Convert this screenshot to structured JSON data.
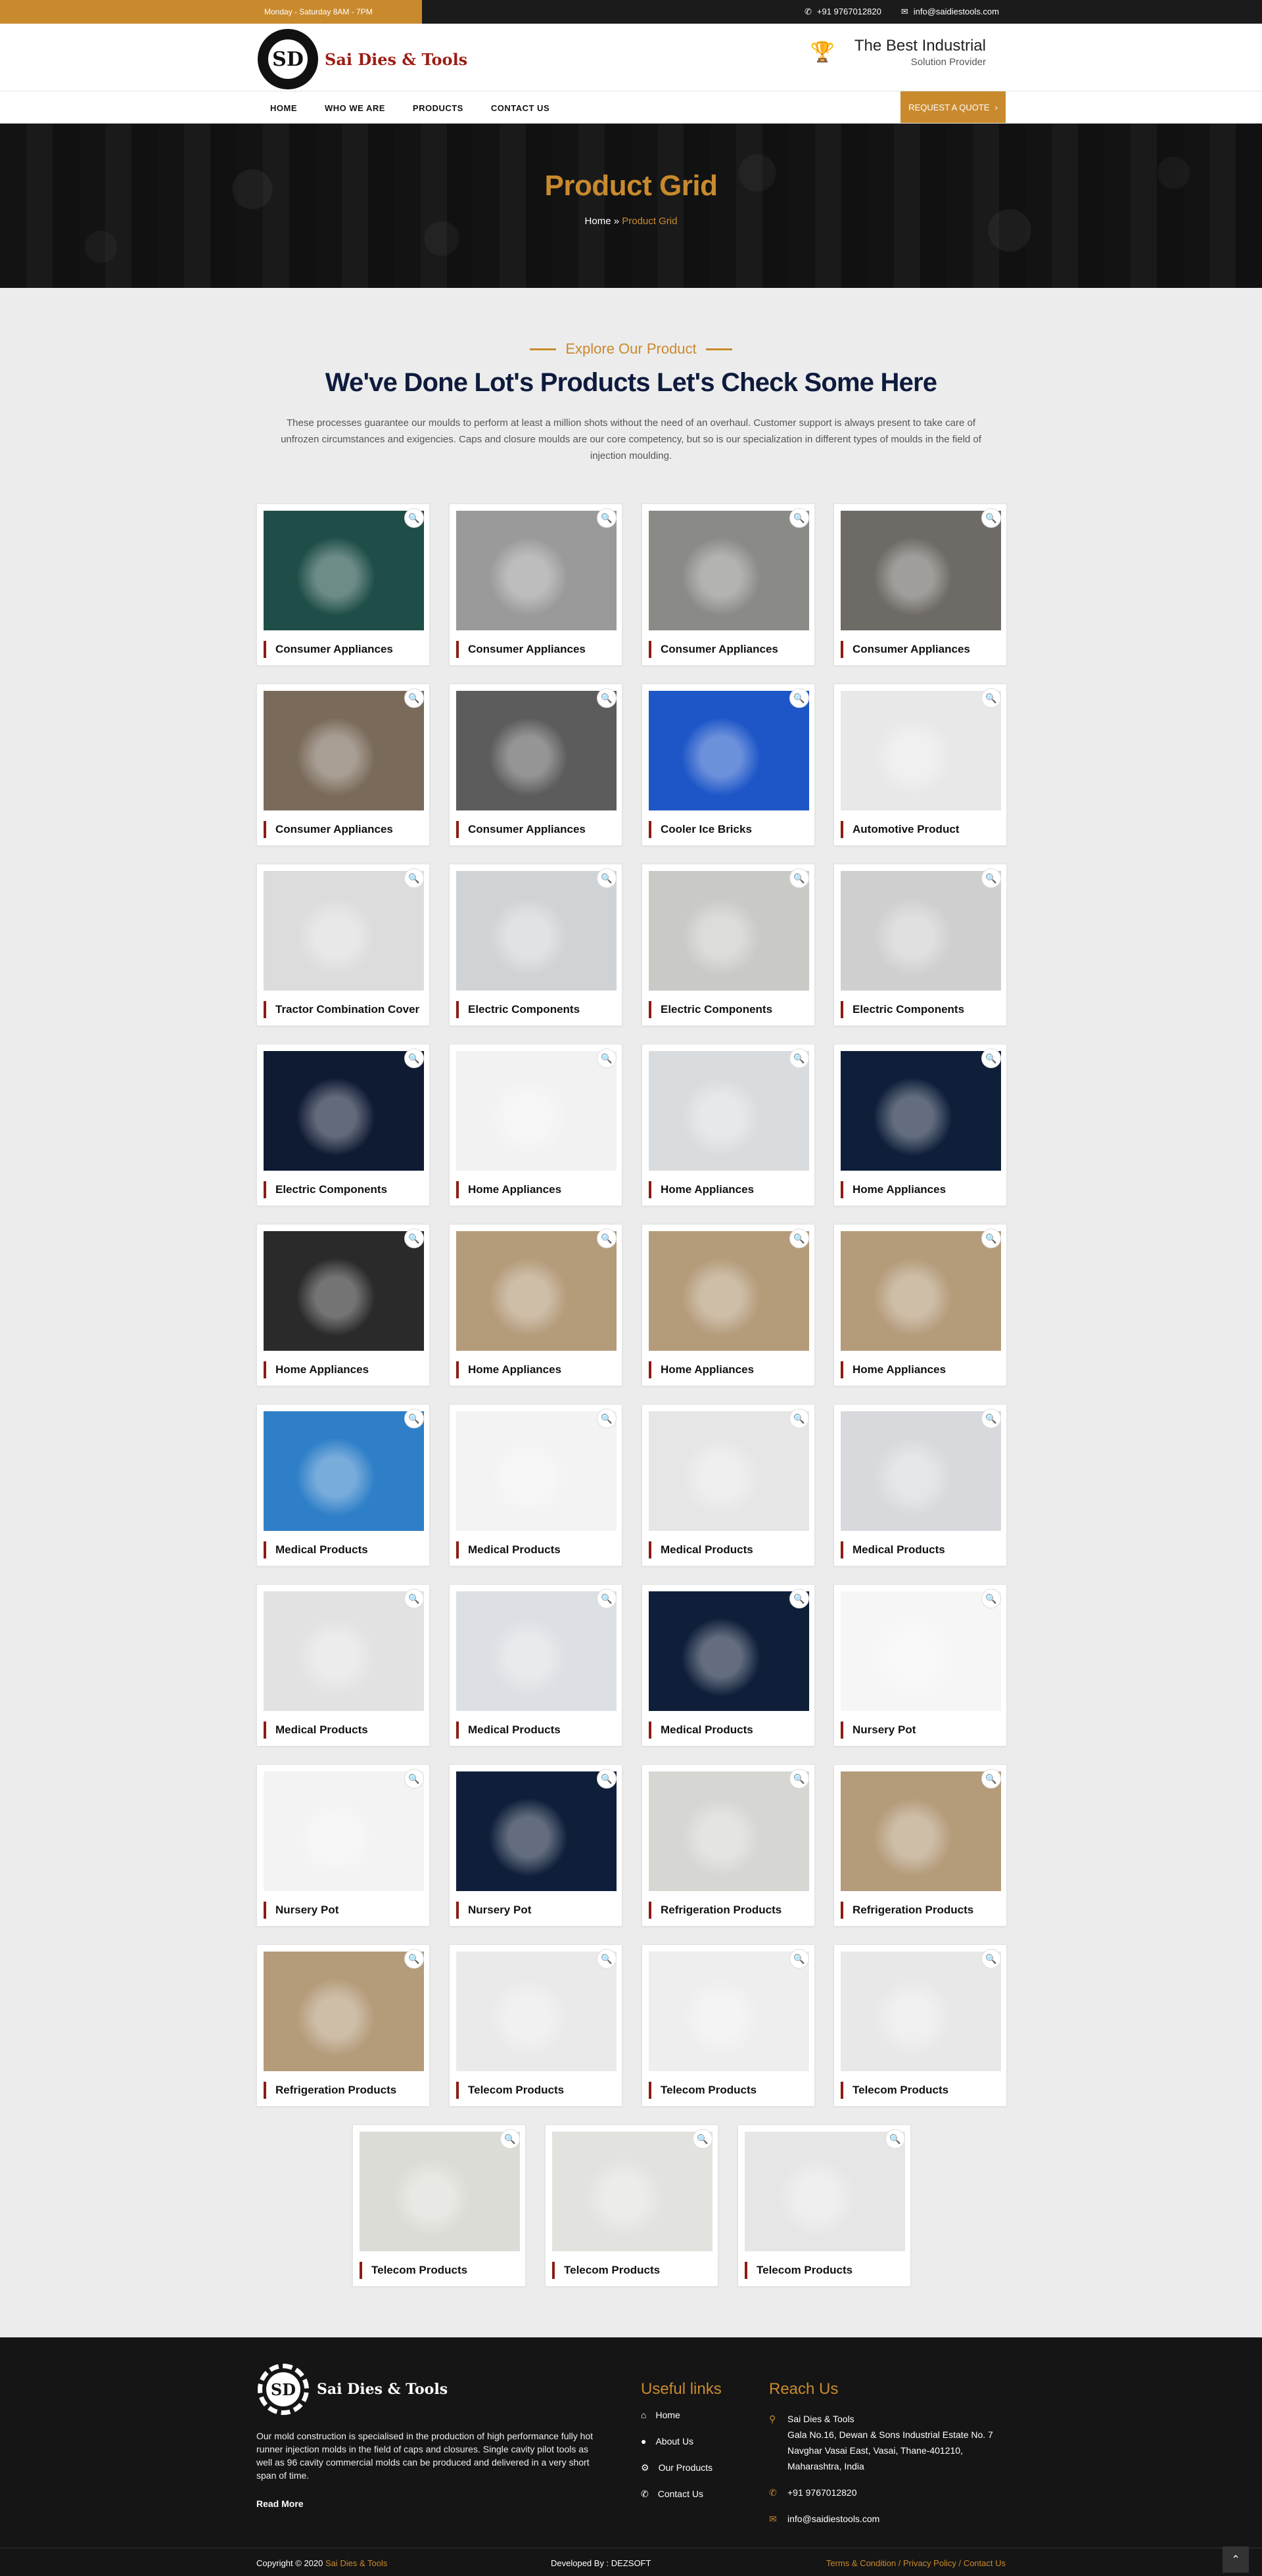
{
  "topbar": {
    "hours": "Monday - Saturday   8AM - 7PM",
    "phone": "+91 9767012820",
    "email": "info@saidiestools.com"
  },
  "brand": {
    "logo_letters": "SD",
    "name": "Sai Dies & Tools"
  },
  "tagline": {
    "line1": "The Best Industrial",
    "line2": "Solution Provider"
  },
  "nav": {
    "items": [
      "HOME",
      "WHO WE ARE",
      "PRODUCTS",
      "CONTACT US"
    ],
    "quote": "REQUEST A QUOTE"
  },
  "hero": {
    "title": "Product Grid",
    "crumb_home": "Home",
    "crumb_sep": "»",
    "crumb_current": "Product Grid"
  },
  "intro": {
    "eyebrow": "Explore Our Product",
    "heading": "We've Done Lot's Products Let's Check Some Here",
    "text": "These processes guarantee our moulds to perform at least a million shots without the need of an overhaul. Customer support is always present to take care of unfrozen circumstances and exigencies. Caps and closure moulds are our core competency, but so is our specialization in different types of moulds in the field of injection moulding."
  },
  "products": [
    "Consumer Appliances",
    "Consumer Appliances",
    "Consumer Appliances",
    "Consumer Appliances",
    "Consumer Appliances",
    "Consumer Appliances",
    "Cooler Ice Bricks",
    "Automotive Product",
    "Tractor Combination Cover",
    "Electric Components",
    "Electric Components",
    "Electric Components",
    "Electric Components",
    "Home Appliances",
    "Home Appliances",
    "Home Appliances",
    "Home Appliances",
    "Home Appliances",
    "Home Appliances",
    "Home Appliances",
    "Medical Products",
    "Medical Products",
    "Medical Products",
    "Medical Products",
    "Medical Products",
    "Medical Products",
    "Medical Products",
    "Nursery Pot",
    "Nursery Pot",
    "Nursery Pot",
    "Refrigeration Products",
    "Refrigeration Products",
    "Refrigeration Products",
    "Telecom Products",
    "Telecom Products",
    "Telecom Products",
    "Telecom Products",
    "Telecom Products",
    "Telecom Products"
  ],
  "photo_tones": [
    "#1f4e48",
    "#9a9a9a",
    "#8a8a86",
    "#6e6a66",
    "#7a6a5a",
    "#5c5c5c",
    "#1e56c8",
    "#e8e8e8",
    "#dcdcdc",
    "#d0d3d6",
    "#c9c9c6",
    "#cfcfcf",
    "#0f1a33",
    "#f2f2f2",
    "#d9dcdf",
    "#0f1f3a",
    "#2a2a2a",
    "#b49b7a",
    "#b49b7a",
    "#b49b7a",
    "#2f7fc8",
    "#f3f3f3",
    "#e6e6e6",
    "#d7d9dc",
    "#e2e2e2",
    "#dcdfe3",
    "#0f1f3a",
    "#f6f6f6",
    "#f3f3f3",
    "#0f1f3a",
    "#d6d6d2",
    "#b49b7a",
    "#b49b7a",
    "#eaeaea",
    "#eeeeee",
    "#e8e8e8",
    "#dcdcd6",
    "#e2e2de",
    "#e6e6e6"
  ],
  "footer": {
    "logo_letters": "SD",
    "name": "Sai Dies & Tools",
    "about": "Our mold construction is specialised in the production of high performance fully hot runner injection molds in the field of caps and closures. Single cavity pilot tools as well as 96 cavity commercial molds can be produced and delivered in a very short span of time.",
    "read_more": "Read More",
    "links_title": "Useful links",
    "links": [
      "Home",
      "About Us",
      "Our Products",
      "Contact Us"
    ],
    "reach_title": "Reach Us",
    "company": "Sai Dies & Tools",
    "address": "Gala No.16, Dewan & Sons Industrial Estate No. 7 Navghar Vasai East, Vasai, Thane-401210, Maharashtra, India",
    "phone": "+91 9767012820",
    "email": "info@saidiestools.com",
    "copyright": "Copyright © 2020",
    "copyright_name": "Sai Dies & Tools",
    "developed": "Developed By : DEZSOFT",
    "bottom_links": "Terms & Condition  /  Privacy Policy  /  Contact Us"
  },
  "colors": {
    "accent": "#c98a2e",
    "brand_red": "#9a1e14",
    "heading_navy": "#0e1b3d",
    "caption_bar": "#8c1c12"
  },
  "icons": {
    "phone": "phone-icon",
    "email": "envelope-icon",
    "zoom": "magnifier-icon",
    "trophy": "trophy-icon"
  }
}
